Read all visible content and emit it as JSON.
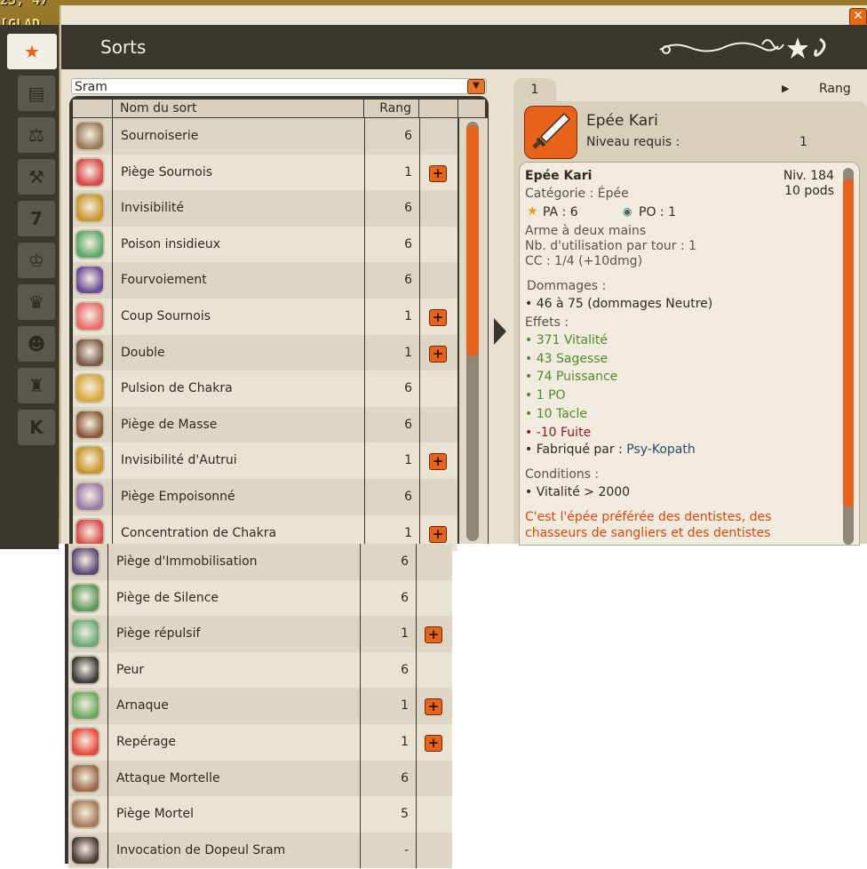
{
  "hud": {
    "line1": "25, 47",
    "line2": "[GLAD"
  },
  "window": {
    "title": "Sorts",
    "close_label": "✕"
  },
  "tabs": [
    {
      "name": "tab-spells",
      "glyph": "★",
      "active": true
    },
    {
      "name": "tab-inventory",
      "glyph": "▤",
      "active": false
    },
    {
      "name": "tab-balance",
      "glyph": "⚖",
      "active": false
    },
    {
      "name": "tab-jobs",
      "glyph": "⚒",
      "active": false
    },
    {
      "name": "tab-calendar",
      "glyph": "7",
      "active": false
    },
    {
      "name": "tab-trophy",
      "glyph": "♔",
      "active": false
    },
    {
      "name": "tab-crown",
      "glyph": "♛",
      "active": false
    },
    {
      "name": "tab-mask",
      "glyph": "☻",
      "active": false
    },
    {
      "name": "tab-helmet",
      "glyph": "♜",
      "active": false
    },
    {
      "name": "tab-k",
      "glyph": "K",
      "active": false
    }
  ],
  "filter": {
    "value": "Sram",
    "arrow": "▼"
  },
  "list": {
    "col_name": "Nom du sort",
    "col_rank": "Rang",
    "rows": [
      {
        "name": "Sournoiserie",
        "rank": "6",
        "plus": false,
        "color": "#9a7a5a"
      },
      {
        "name": "Piège Sournois",
        "rank": "1",
        "plus": true,
        "color": "#d84a4a"
      },
      {
        "name": "Invisibilité",
        "rank": "6",
        "plus": false,
        "color": "#c8962a"
      },
      {
        "name": "Poison insidieux",
        "rank": "6",
        "plus": false,
        "color": "#5aa86a"
      },
      {
        "name": "Fourvoiement",
        "rank": "6",
        "plus": false,
        "color": "#6a4a9a"
      },
      {
        "name": "Coup Sournois",
        "rank": "1",
        "plus": true,
        "color": "#e86a6a"
      },
      {
        "name": "Double",
        "rank": "1",
        "plus": true,
        "color": "#7a5a4a"
      },
      {
        "name": "Pulsion de Chakra",
        "rank": "6",
        "plus": false,
        "color": "#d8a83a"
      },
      {
        "name": "Piège de Masse",
        "rank": "6",
        "plus": false,
        "color": "#8a5a3a"
      },
      {
        "name": "Invisibilité d'Autrui",
        "rank": "1",
        "plus": true,
        "color": "#c8962a"
      },
      {
        "name": "Piège Empoisonné",
        "rank": "6",
        "plus": false,
        "color": "#9a7aa8"
      },
      {
        "name": "Concentration de Chakra",
        "rank": "1",
        "plus": true,
        "color": "#d84a4a"
      }
    ],
    "lower_rows": [
      {
        "name": "Piège d'Immobilisation",
        "rank": "6",
        "plus": false,
        "color": "#5a4a7a"
      },
      {
        "name": "Piège de Silence",
        "rank": "6",
        "plus": false,
        "color": "#5a9a5a"
      },
      {
        "name": "Piège répulsif",
        "rank": "1",
        "plus": true,
        "color": "#6aa87a"
      },
      {
        "name": "Peur",
        "rank": "6",
        "plus": false,
        "color": "#3a3a3a"
      },
      {
        "name": "Arnaque",
        "rank": "1",
        "plus": true,
        "color": "#6aa85a"
      },
      {
        "name": "Repérage",
        "rank": "1",
        "plus": true,
        "color": "#e84a3a"
      },
      {
        "name": "Attaque Mortelle",
        "rank": "6",
        "plus": false,
        "color": "#9a6a4a"
      },
      {
        "name": "Piège Mortel",
        "rank": "5",
        "plus": false,
        "color": "#a87a5a"
      },
      {
        "name": "Invocation de Dopeul Sram",
        "rank": "-",
        "plus": false,
        "color": "#4a3a3a"
      }
    ]
  },
  "detail": {
    "tab_label": "1",
    "tab_arrow": "▶",
    "tab_rank": "Rang",
    "item_name": "Epée Kari",
    "level_req_label": "Niveau requis :",
    "level_req_value": "1",
    "title": "Epée Kari",
    "level": "Niv. 184",
    "weight": "10 pods",
    "category": "Catégorie : Épée",
    "pa": "PA : 6",
    "po": "PO : 1",
    "hands": "Arme à deux mains",
    "uses": "Nb. d'utilisation par tour : 1",
    "cc": "CC : 1/4 (+10dmg)",
    "damage_title": "Dommages :",
    "damage": "• 46 à 75 (dommages Neutre)",
    "effects_title": "Effets :",
    "effects": [
      {
        "text": "• 371 Vitalité",
        "cls": "g"
      },
      {
        "text": "• 43 Sagesse",
        "cls": "g"
      },
      {
        "text": "• 74 Puissance",
        "cls": "g"
      },
      {
        "text": "• 1 PO",
        "cls": "g"
      },
      {
        "text": "• 10 Tacle",
        "cls": "g"
      },
      {
        "text": "• -10 Fuite",
        "cls": "r"
      }
    ],
    "crafted_label": "• Fabriqué par : ",
    "crafted_by": "Psy-Kopath",
    "conditions_title": "Conditions :",
    "condition": "• Vitalité > 2000",
    "flavor_1": "C'est l'épée préférée des dentistes, des",
    "flavor_2": "chasseurs de sangliers et des dentistes"
  },
  "colors": {
    "accent": "#e8621a",
    "dark": "#3a3630",
    "panel": "#d8d0bd"
  }
}
